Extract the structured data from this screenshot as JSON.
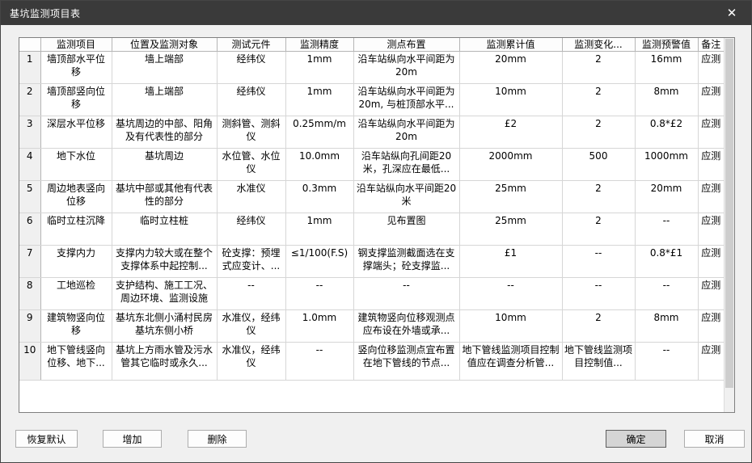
{
  "window": {
    "title": "基坑监测项目表",
    "close_icon": "✕"
  },
  "colors": {
    "titlebar_bg": "#3a3a3a",
    "dialog_bg": "#f0f0f0",
    "table_bg": "#ffffff",
    "rownum_bg": "#f0f0f0",
    "default_button_bg": "#d5d5d5"
  },
  "table": {
    "columns": [
      "",
      "监测项目",
      "位置及监测对象",
      "测试元件",
      "监测精度",
      "测点布置",
      "监测累计值",
      "监测变化...",
      "监测预警值",
      "备注"
    ],
    "rows": [
      [
        "1",
        "墙顶部水平位移",
        "墙上端部",
        "经纬仪",
        "1mm",
        "沿车站纵向水平间距为20m",
        "20mm",
        "2",
        "16mm",
        "应测"
      ],
      [
        "2",
        "墙顶部竖向位移",
        "墙上端部",
        "经纬仪",
        "1mm",
        "沿车站纵向水平间距为20m, 与桩顶部水平...",
        "10mm",
        "2",
        "8mm",
        "应测"
      ],
      [
        "3",
        "深层水平位移",
        "基坑周边的中部、阳角及有代表性的部分",
        "测斜管、测斜仪",
        "0.25mm/m",
        "沿车站纵向水平间距为20m",
        "£2",
        "2",
        "0.8*£2",
        "应测"
      ],
      [
        "4",
        "地下水位",
        "基坑周边",
        "水位管、水位仪",
        "10.0mm",
        "沿车站纵向孔间距20米，孔深应在最低...",
        "2000mm",
        "500",
        "1000mm",
        "应测"
      ],
      [
        "5",
        "周边地表竖向位移",
        "基坑中部或其他有代表性的部分",
        "水准仪",
        "0.3mm",
        "沿车站纵向水平间距20米",
        "25mm",
        "2",
        "20mm",
        "应测"
      ],
      [
        "6",
        "临时立柱沉降",
        "临时立柱桩",
        "经纬仪",
        "1mm",
        "见布置图",
        "25mm",
        "2",
        "--",
        "应测"
      ],
      [
        "7",
        "支撑内力",
        "支撑内力较大或在整个支撑体系中起控制...",
        "砼支撑：预埋式应变计、...",
        "≤1/100(F.S)",
        "钢支撑监测截面选在支撑端头；砼支撑监...",
        "£1",
        "--",
        "0.8*£1",
        "应测"
      ],
      [
        "8",
        "工地巡检",
        "支护结构、施工工况、周边环境、监测设施",
        "--",
        "--",
        "--",
        "--",
        "--",
        "--",
        "应测"
      ],
      [
        "9",
        "建筑物竖向位移",
        "基坑东北侧小涌村民房基坑东侧小桥",
        "水准仪，经纬仪",
        "1.0mm",
        "建筑物竖向位移观测点应布设在外墙或承...",
        "10mm",
        "2",
        "8mm",
        "应测"
      ],
      [
        "10",
        "地下管线竖向位移、地下...",
        "基坑上方雨水管及污水管其它临时或永久...",
        "水准仪，经纬仪",
        "--",
        "竖向位移监测点宜布置在地下管线的节点...",
        "地下管线监测项目控制值应在调查分析管...",
        "地下管线监测项目控制值...",
        "--",
        "应测"
      ]
    ]
  },
  "buttons": {
    "restore": "恢复默认",
    "add": "增加",
    "delete": "删除",
    "ok": "确定",
    "cancel": "取消"
  }
}
